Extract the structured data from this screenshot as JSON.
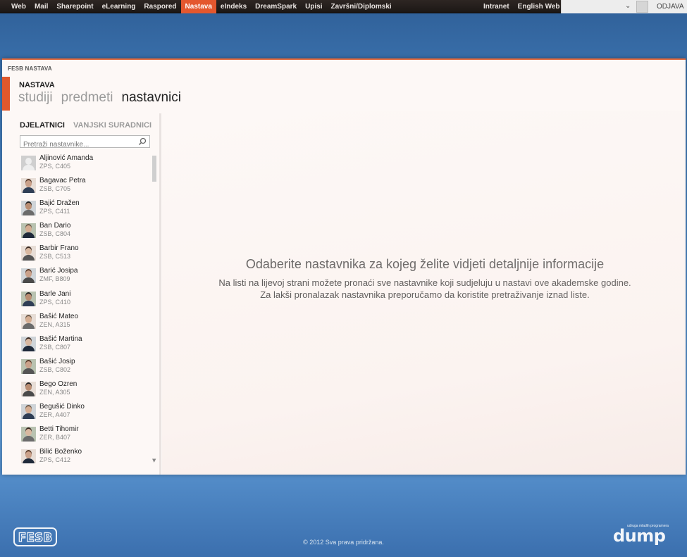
{
  "topnav": {
    "items": [
      "Web",
      "Mail",
      "Sharepoint",
      "eLearning",
      "Raspored",
      "Nastava",
      "eIndeks",
      "DreamSpark",
      "Upisi",
      "Završni/Diplomski"
    ],
    "active_index": 5,
    "right_items": [
      "Intranet",
      "English Web"
    ],
    "logout_label": "ODJAVA",
    "accent": "#e4572e"
  },
  "header": {
    "breadcrumb": "FESB NASTAVA",
    "section_title": "NASTAVA",
    "tabs": [
      "studiji",
      "predmeti",
      "nastavnici"
    ],
    "active_tab": "nastavnici"
  },
  "sidebar": {
    "tabs": [
      "DJELATNICI",
      "VANJSKI SURADNICI"
    ],
    "search_placeholder": "Pretraži nastavnike...",
    "people": [
      {
        "name": "Aljinović Amanda",
        "location": "ZPS, C405"
      },
      {
        "name": "Bagavac Petra",
        "location": "ZSB, C705"
      },
      {
        "name": "Bajić Dražen",
        "location": "ZPS, C411"
      },
      {
        "name": "Ban Dario",
        "location": "ZSB, C804"
      },
      {
        "name": "Barbir Frano",
        "location": "ZSB, C513"
      },
      {
        "name": "Barić Josipa",
        "location": "ZMF, B809"
      },
      {
        "name": "Barle Jani",
        "location": "ZPS, C410"
      },
      {
        "name": "Bašić Mateo",
        "location": "ZEN, A315"
      },
      {
        "name": "Bašić Martina",
        "location": "ZSB, C807"
      },
      {
        "name": "Bašić Josip",
        "location": "ZSB, C802"
      },
      {
        "name": "Bego Ozren",
        "location": "ZEN, A305"
      },
      {
        "name": "Begušić Dinko",
        "location": "ZER, A407"
      },
      {
        "name": "Betti Tihomir",
        "location": "ZER, B407"
      },
      {
        "name": "Bilić Boženko",
        "location": "ZPS, C412"
      }
    ]
  },
  "main": {
    "heading": "Odaberite nastavnika za kojeg želite vidjeti detaljnije informacije",
    "line1": "Na listi na lijevoj strani možete pronaći sve nastavnike koji sudjeluju u nastavi ove akademske godine.",
    "line2": "Za lakši pronalazak nastavnika preporučamo da koristite pretraživanje iznad liste."
  },
  "footer": {
    "copyright": "© 2012 Sva prava pridržana.",
    "left_logo": "FESB",
    "right_logo": "dump",
    "right_logo_tagline": "udruga mladih programera"
  }
}
